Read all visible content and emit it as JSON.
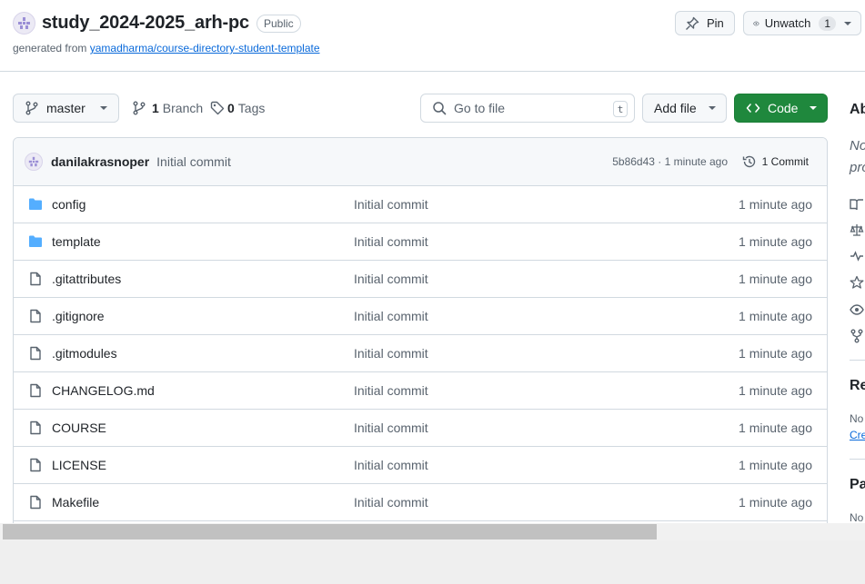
{
  "repo": {
    "name": "study_2024-2025_arh-pc",
    "visibility": "Public",
    "generated_prefix": "generated from",
    "template_link": "yamadharma/course-directory-student-template"
  },
  "header_actions": {
    "pin_label": "Pin",
    "watch_label": "Unwatch",
    "watch_count": "1"
  },
  "toolbar": {
    "branch": "master",
    "branch_count": "1",
    "branch_label": "Branch",
    "tag_count": "0",
    "tag_label": "Tags",
    "goto_placeholder": "Go to file",
    "goto_shortcut": "t",
    "add_file_label": "Add file",
    "code_label": "Code"
  },
  "latest_commit": {
    "author": "danilakrasnoper",
    "message": "Initial commit",
    "hash_time": "5b86d43 · 1 minute ago",
    "commits_label": "1 Commit"
  },
  "files": [
    {
      "name": "config",
      "type": "folder",
      "message": "Initial commit",
      "time": "1 minute ago"
    },
    {
      "name": "template",
      "type": "folder",
      "message": "Initial commit",
      "time": "1 minute ago"
    },
    {
      "name": ".gitattributes",
      "type": "file",
      "message": "Initial commit",
      "time": "1 minute ago"
    },
    {
      "name": ".gitignore",
      "type": "file",
      "message": "Initial commit",
      "time": "1 minute ago"
    },
    {
      "name": ".gitmodules",
      "type": "file",
      "message": "Initial commit",
      "time": "1 minute ago"
    },
    {
      "name": "CHANGELOG.md",
      "type": "file",
      "message": "Initial commit",
      "time": "1 minute ago"
    },
    {
      "name": "COURSE",
      "type": "file",
      "message": "Initial commit",
      "time": "1 minute ago"
    },
    {
      "name": "LICENSE",
      "type": "file",
      "message": "Initial commit",
      "time": "1 minute ago"
    },
    {
      "name": "Makefile",
      "type": "file",
      "message": "Initial commit",
      "time": "1 minute ago"
    }
  ],
  "sidebar": {
    "about_title": "Ab",
    "about_note_line1": "No",
    "about_note_line2": "pro",
    "releases_title": "Re",
    "releases_note": "No",
    "releases_link": "Cre",
    "packages_title": "Pa",
    "packages_note": "No",
    "icons": [
      "book-icon",
      "law-icon",
      "pulse-icon",
      "star-icon",
      "eye-icon",
      "fork-icon"
    ]
  },
  "colors": {
    "accent": "#1f883d",
    "link": "#0969da",
    "folder": "#54aeff",
    "muted": "#59636e",
    "border": "#d1d9e0"
  }
}
